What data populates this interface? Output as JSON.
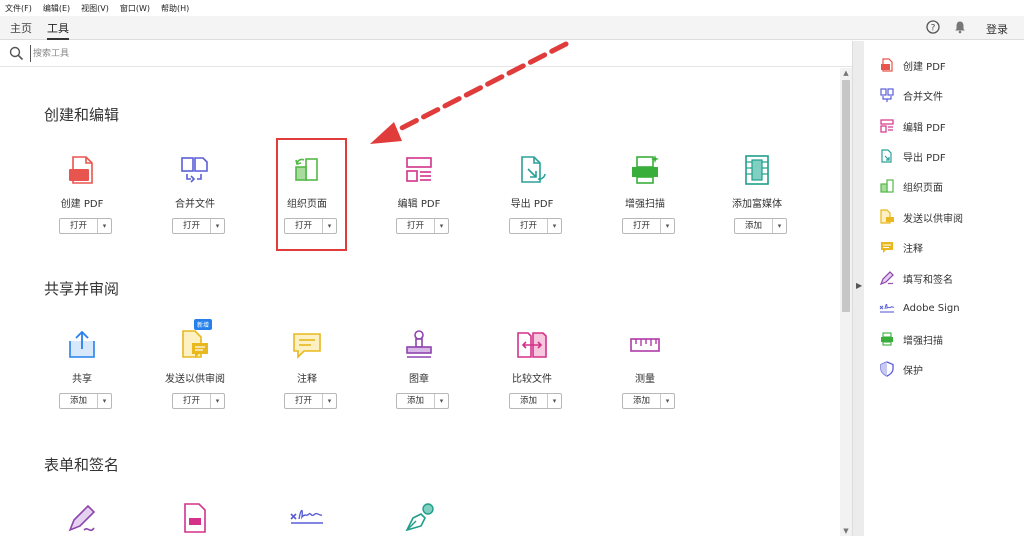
{
  "menu": [
    "文件(F)",
    "编辑(E)",
    "视图(V)",
    "窗口(W)",
    "帮助(H)"
  ],
  "tabs": {
    "home": "主页",
    "tools": "工具"
  },
  "topbar": {
    "login": "登录"
  },
  "search": {
    "placeholder": "搜索工具"
  },
  "sections": {
    "create_edit": "创建和编辑",
    "share_review": "共享并审阅",
    "forms_sign": "表单和签名"
  },
  "tools_row1": [
    {
      "label": "创建 PDF",
      "button": "打开",
      "icon": "create-pdf-icon",
      "color": "#e8554e"
    },
    {
      "label": "合并文件",
      "button": "打开",
      "icon": "combine-files-icon",
      "color": "#5a5fd6"
    },
    {
      "label": "组织页面",
      "button": "打开",
      "icon": "organize-pages-icon",
      "color": "#54b848"
    },
    {
      "label": "编辑 PDF",
      "button": "打开",
      "icon": "edit-pdf-icon",
      "color": "#d4318a"
    },
    {
      "label": "导出 PDF",
      "button": "打开",
      "icon": "export-pdf-icon",
      "color": "#2aa198"
    },
    {
      "label": "增强扫描",
      "button": "打开",
      "icon": "enhance-scan-icon",
      "color": "#3aae3a"
    },
    {
      "label": "添加富媒体",
      "button": "添加",
      "icon": "rich-media-icon",
      "color": "#1f9e8a"
    }
  ],
  "tools_row2": [
    {
      "label": "共享",
      "button": "添加",
      "icon": "share-icon",
      "color": "#2680eb"
    },
    {
      "label": "发送以供审阅",
      "button": "打开",
      "icon": "send-review-icon",
      "color": "#e8b81e",
      "badge": "新增"
    },
    {
      "label": "注释",
      "button": "打开",
      "icon": "comment-icon",
      "color": "#e8b81e"
    },
    {
      "label": "图章",
      "button": "添加",
      "icon": "stamp-icon",
      "color": "#8e44ad"
    },
    {
      "label": "比较文件",
      "button": "添加",
      "icon": "compare-icon",
      "color": "#d4318a"
    },
    {
      "label": "测量",
      "button": "添加",
      "icon": "measure-icon",
      "color": "#b03aa8"
    }
  ],
  "right_panel": [
    {
      "label": "创建 PDF",
      "icon": "create-pdf-icon",
      "color": "#e8554e"
    },
    {
      "label": "合并文件",
      "icon": "combine-files-icon",
      "color": "#5a5fd6"
    },
    {
      "label": "编辑 PDF",
      "icon": "edit-pdf-icon",
      "color": "#d4318a"
    },
    {
      "label": "导出 PDF",
      "icon": "export-pdf-icon",
      "color": "#2aa198"
    },
    {
      "label": "组织页面",
      "icon": "organize-pages-icon",
      "color": "#54b848"
    },
    {
      "label": "发送以供审阅",
      "icon": "send-review-icon",
      "color": "#e8b81e"
    },
    {
      "label": "注释",
      "icon": "comment-icon",
      "color": "#e8b81e"
    },
    {
      "label": "填写和签名",
      "icon": "fill-sign-icon",
      "color": "#8e44ad"
    },
    {
      "label": "Adobe Sign",
      "icon": "adobe-sign-icon",
      "color": "#5a5fd6"
    },
    {
      "label": "增强扫描",
      "icon": "enhance-scan-icon",
      "color": "#3aae3a"
    },
    {
      "label": "保护",
      "icon": "protect-icon",
      "color": "#5a5fd6"
    }
  ]
}
